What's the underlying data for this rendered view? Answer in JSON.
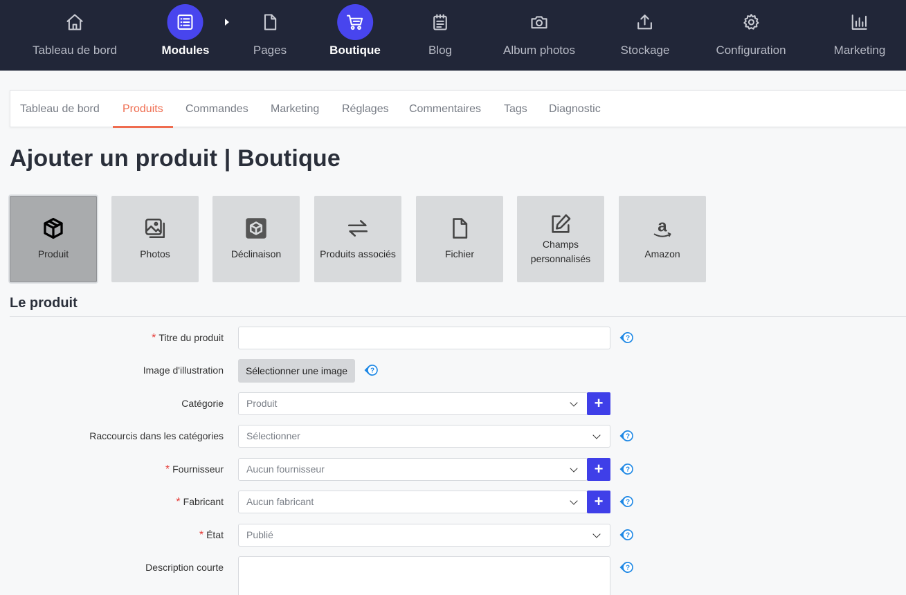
{
  "topnav": {
    "items": [
      {
        "label": "Tableau de bord",
        "icon": "home-icon"
      },
      {
        "label": "Modules",
        "icon": "list-icon"
      },
      {
        "label": "Pages",
        "icon": "page-icon"
      },
      {
        "label": "Boutique",
        "icon": "cart-icon"
      },
      {
        "label": "Blog",
        "icon": "notepad-icon"
      },
      {
        "label": "Album photos",
        "icon": "camera-icon"
      },
      {
        "label": "Stockage",
        "icon": "upload-icon"
      },
      {
        "label": "Configuration",
        "icon": "gear-icon"
      },
      {
        "label": "Marketing",
        "icon": "bar-chart-icon"
      }
    ],
    "active": [
      "Modules",
      "Boutique"
    ],
    "accent": "#4845ee",
    "background": "#212638"
  },
  "subtabs": {
    "items": [
      "Tableau de bord",
      "Produits",
      "Commandes",
      "Marketing",
      "Réglages",
      "Commentaires",
      "Tags",
      "Diagnostic"
    ],
    "active": "Produits",
    "accent": "#ef6c4f"
  },
  "page_title": "Ajouter un produit | Boutique",
  "tiles": {
    "items": [
      {
        "label": "Produit",
        "icon": "box-icon"
      },
      {
        "label": "Photos",
        "icon": "images-icon"
      },
      {
        "label": "Déclinaison",
        "icon": "box-square-icon"
      },
      {
        "label": "Produits associés",
        "icon": "swap-arrows-icon"
      },
      {
        "label": "Fichier",
        "icon": "file-icon"
      },
      {
        "label_line1": "Champs",
        "label_line2": "personnalisés",
        "icon": "edit-icon"
      },
      {
        "label": "Amazon",
        "icon": "amazon-icon"
      }
    ],
    "active": "Produit"
  },
  "section_title": "Le produit",
  "form": {
    "required_mark": "*",
    "title": {
      "label": "Titre du produit",
      "value": ""
    },
    "image": {
      "label": "Image d'illustration",
      "button": "Sélectionner une image"
    },
    "category": {
      "label": "Catégorie",
      "value": "Produit"
    },
    "shortcuts": {
      "label": "Raccourcis dans les catégories",
      "value": "Sélectionner"
    },
    "supplier": {
      "label": "Fournisseur",
      "value": "Aucun fournisseur"
    },
    "manufacturer": {
      "label": "Fabricant",
      "value": "Aucun fabricant"
    },
    "state": {
      "label": "État",
      "value": "Publié"
    },
    "short_description": {
      "label": "Description courte",
      "value": ""
    },
    "plus_label": "+",
    "help_color": "#1e88e5"
  }
}
